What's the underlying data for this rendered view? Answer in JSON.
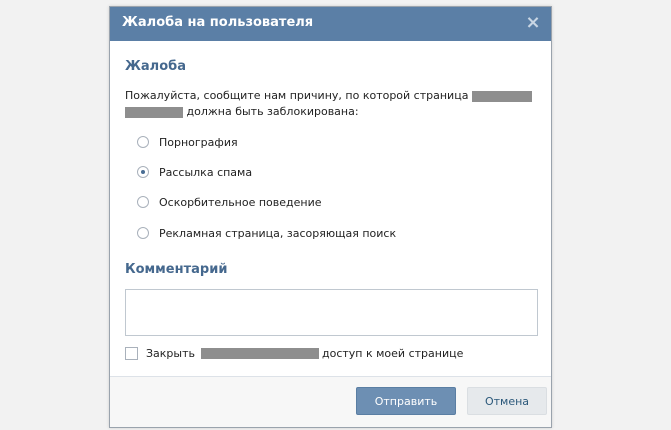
{
  "dialog": {
    "title": "Жалоба на пользователя",
    "close_icon": "×"
  },
  "complaint": {
    "heading": "Жалоба",
    "desc_part1": "Пожалуйста, сообщите нам причину, по которой страница",
    "desc_part2": "должна быть заблокирована:",
    "options": [
      {
        "label": "Порнография",
        "checked": false
      },
      {
        "label": "Рассылка спама",
        "checked": true
      },
      {
        "label": "Оскорбительное поведение",
        "checked": false
      },
      {
        "label": "Рекламная страница, засоряющая поиск",
        "checked": false
      }
    ]
  },
  "comment": {
    "heading": "Комментарий",
    "value": ""
  },
  "block": {
    "label_part1": "Закрыть",
    "label_part2": "доступ к моей странице",
    "checked": false
  },
  "footer": {
    "send_label": "Отправить",
    "cancel_label": "Отмена"
  },
  "colors": {
    "title_bar": "#5b7fa6",
    "heading": "#45688e",
    "send_button": "#6d8fb3"
  }
}
